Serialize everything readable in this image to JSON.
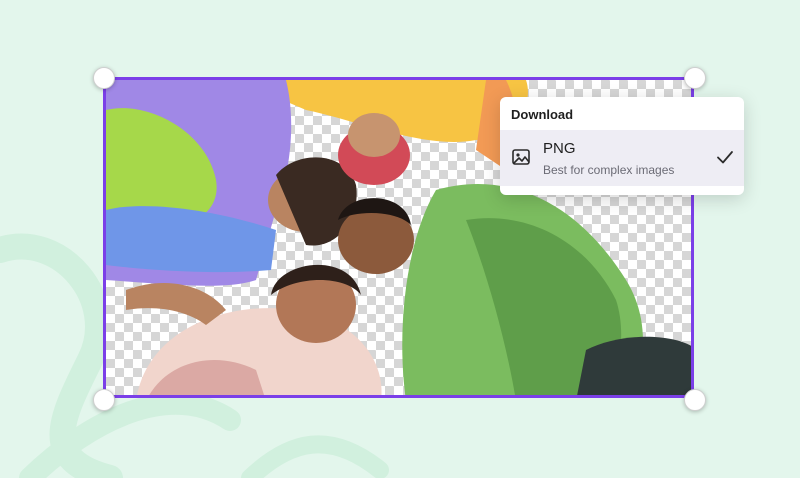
{
  "download_menu": {
    "title": "Download",
    "option": {
      "name": "PNG",
      "description": "Best for complex images",
      "selected": true
    }
  },
  "colors": {
    "background": "#e3f6ec",
    "selection_border": "#7b3fe8",
    "menu_option_bg": "#eeedf4"
  },
  "icons": [
    "image-icon",
    "checkmark-icon"
  ]
}
